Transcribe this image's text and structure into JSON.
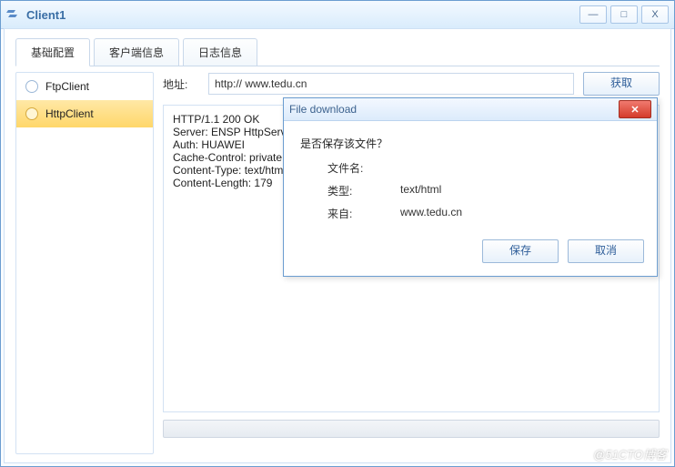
{
  "window": {
    "title": "Client1",
    "controls": {
      "min": "—",
      "max": "□",
      "close": "X"
    }
  },
  "tabs": [
    {
      "label": "基础配置"
    },
    {
      "label": "客户端信息"
    },
    {
      "label": "日志信息"
    }
  ],
  "sidebar": {
    "items": [
      {
        "label": "FtpClient"
      },
      {
        "label": "HttpClient"
      }
    ]
  },
  "main": {
    "url_label": "地址:",
    "url_value": "http:// www.tedu.cn",
    "fetch_label": "获取",
    "response_text": "HTTP/1.1 200 OK\nServer: ENSP HttpServer\nAuth: HUAWEI\nCache-Control: private\nContent-Type: text/html\nContent-Length: 179"
  },
  "dialog": {
    "title": "File download",
    "question": "是否保存该文件？",
    "rows": {
      "filename_label": "文件名:",
      "filename_value": "",
      "type_label": "类型:",
      "type_value": "text/html",
      "from_label": "来自:",
      "from_value": "www.tedu.cn"
    },
    "save_label": "保存",
    "cancel_label": "取消"
  },
  "watermark": "@51CTO博客"
}
